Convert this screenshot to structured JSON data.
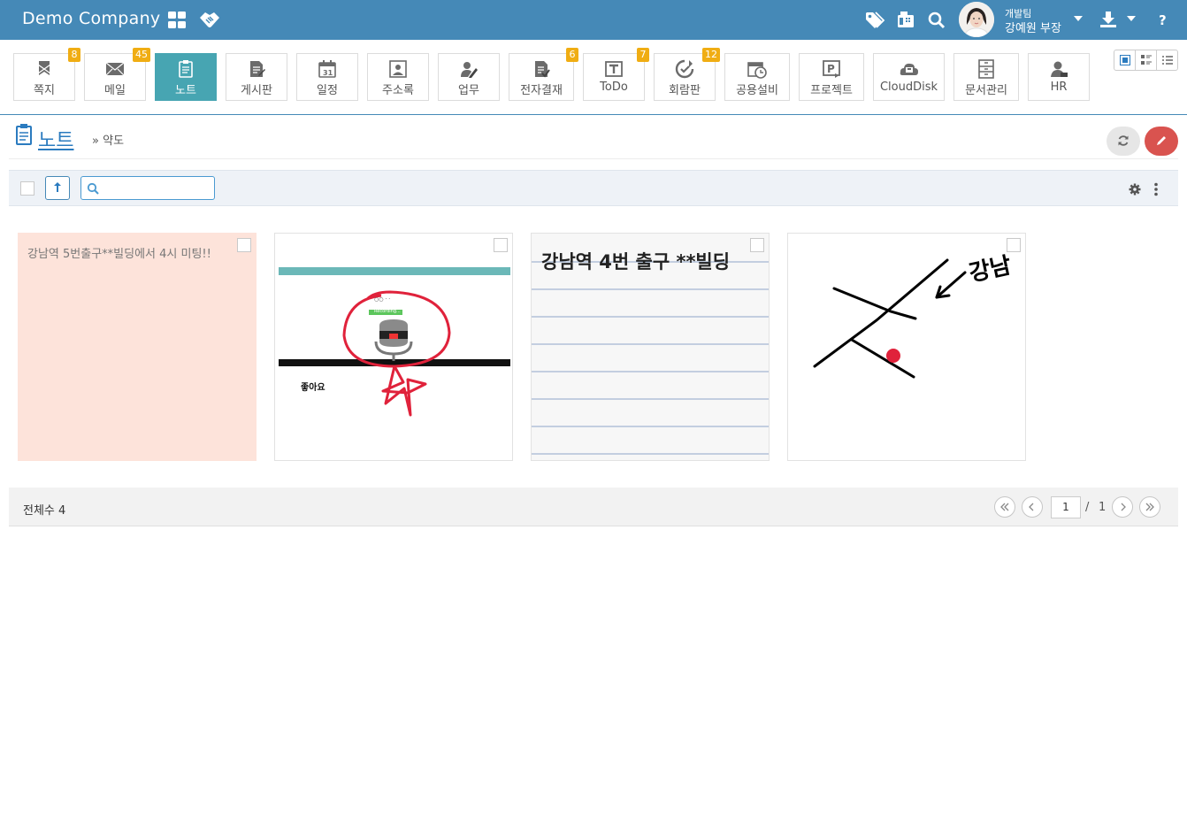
{
  "header": {
    "brand": "Demo Company",
    "user_team": "개발팀",
    "user_name": "강예원 부장"
  },
  "modules": [
    {
      "label": "쪽지",
      "badge": "8"
    },
    {
      "label": "메일",
      "badge": "45"
    },
    {
      "label": "노트",
      "badge": ""
    },
    {
      "label": "게시판",
      "badge": ""
    },
    {
      "label": "일정",
      "badge": ""
    },
    {
      "label": "주소록",
      "badge": ""
    },
    {
      "label": "업무",
      "badge": ""
    },
    {
      "label": "전자결재",
      "badge": "6"
    },
    {
      "label": "ToDo",
      "badge": "7"
    },
    {
      "label": "회람판",
      "badge": "12"
    },
    {
      "label": "공용설비",
      "badge": ""
    },
    {
      "label": "프로젝트",
      "badge": ""
    },
    {
      "label": "CloudDisk",
      "badge": ""
    },
    {
      "label": "문서관리",
      "badge": ""
    },
    {
      "label": "HR",
      "badge": ""
    }
  ],
  "page": {
    "title": "노트",
    "breadcrumb": "약도"
  },
  "toolbar": {
    "search_placeholder": ""
  },
  "notes": [
    {
      "text": "강남역 5번출구**빌딩에서 4시 미팅!!",
      "color": "#fde3da"
    },
    {
      "caption": "좋아요",
      "mock_label": "Recording..."
    },
    {
      "text": "강남역 4번 출구 **빌딩"
    },
    {
      "text": "강남"
    }
  ],
  "footer": {
    "total": "전체수 4",
    "current_page": "1",
    "page_sep": "/",
    "total_pages": "1"
  },
  "colors": {
    "header": "#4589b7",
    "active_module": "#47a5b2",
    "badge": "#f0ad13",
    "edit_button": "#d9534f"
  }
}
